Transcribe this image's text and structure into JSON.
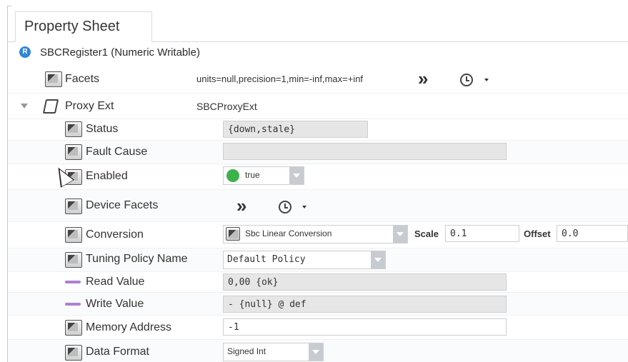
{
  "tab": {
    "title": "Property Sheet"
  },
  "root": {
    "badge": "R",
    "label": "SBCRegister1  (Numeric Writable)"
  },
  "facets": {
    "label": "Facets",
    "value": "units=null,precision=1,min=-inf,max=+inf"
  },
  "proxy_ext": {
    "label": "Proxy Ext",
    "value": "SBCProxyExt"
  },
  "props": {
    "status": {
      "label": "Status",
      "value": "{down,stale}"
    },
    "fault_cause": {
      "label": "Fault Cause",
      "value": ""
    },
    "enabled": {
      "label": "Enabled",
      "value": "true"
    },
    "device_facets": {
      "label": "Device Facets"
    },
    "conversion": {
      "label": "Conversion",
      "value": "Sbc Linear Conversion",
      "scale_label": "Scale",
      "scale_value": "0.1",
      "offset_label": "Offset",
      "offset_value": "0.0"
    },
    "tuning_policy": {
      "label": "Tuning Policy Name",
      "value": "Default Policy"
    },
    "read_value": {
      "label": "Read Value",
      "value": "0,00 {ok}"
    },
    "write_value": {
      "label": "Write Value",
      "value": "- {null} @ def"
    },
    "memory_address": {
      "label": "Memory Address",
      "value": "-1"
    },
    "data_format": {
      "label": "Data Format",
      "value": "Signed Int"
    }
  },
  "colors": {
    "accent": "#2f86d6",
    "ok_green": "#3bb34a",
    "dash_purple": "#b07ed1",
    "dropdown_btn": "#c7ccd3"
  },
  "icons": [
    "slot-icon",
    "proxy-ext-icon",
    "double-chevron-icon",
    "clock-icon",
    "dropdown-caret-icon",
    "mouse-cursor-icon"
  ]
}
